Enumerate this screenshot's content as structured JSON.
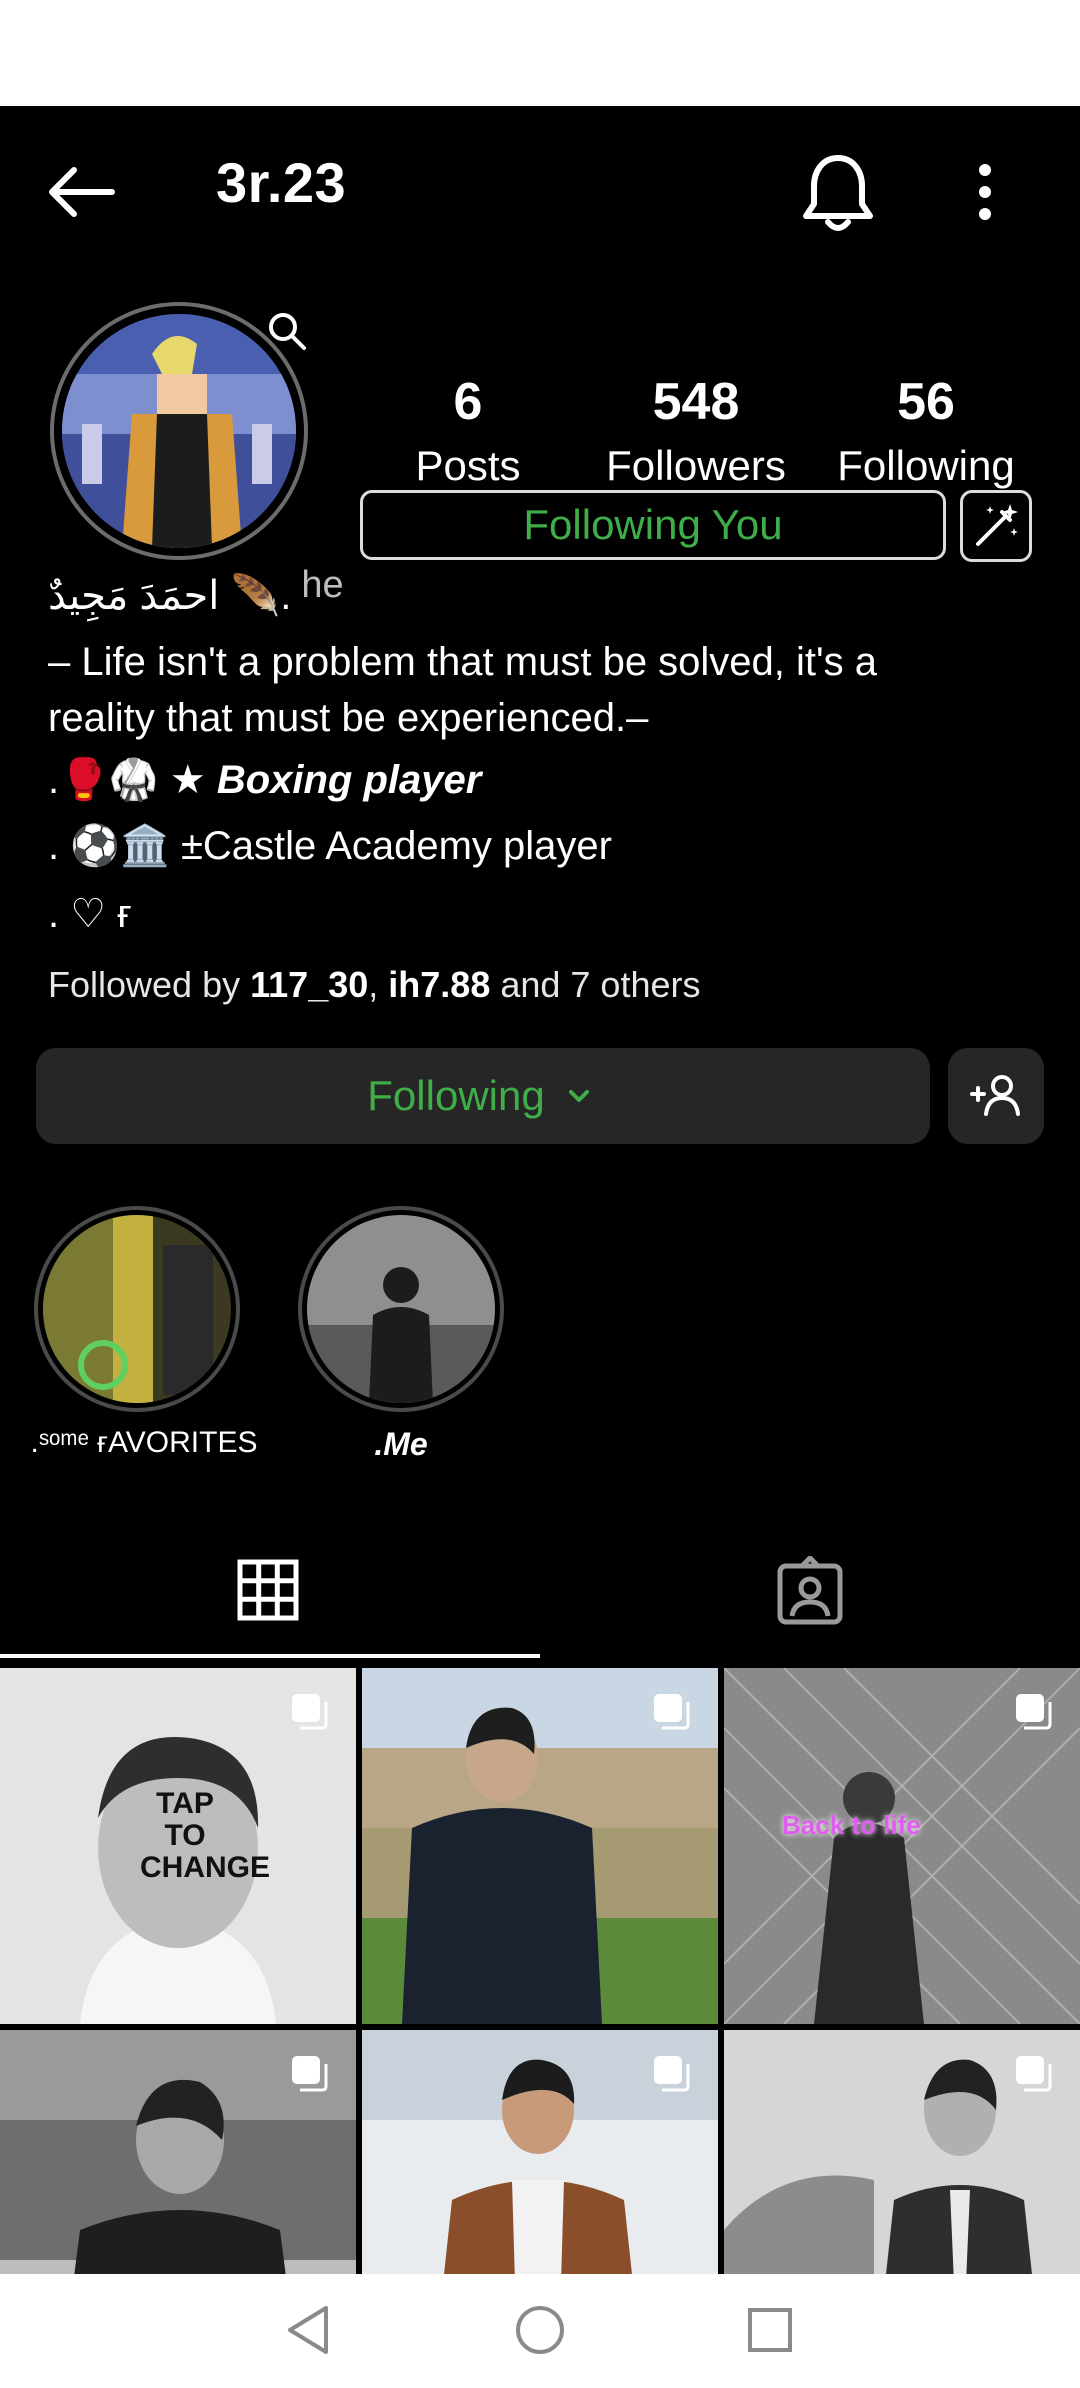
{
  "header": {
    "username": "3r.23"
  },
  "stats": [
    {
      "value": "6",
      "label": "Posts"
    },
    {
      "value": "548",
      "label": "Followers"
    },
    {
      "value": "56",
      "label": "Following"
    }
  ],
  "follows_you_label": "Following You",
  "bio": {
    "name": "احمَدَ مَجِيدٌ 🪶.",
    "name_suffix": "he",
    "line1": "– Life isn't a problem that must be solved, it's a",
    "line2": "reality that must be experienced.–",
    "line3_prefix": ".🥊🥋 ★ ",
    "line3_bold": "Boxing player",
    "line4": " .  ⚽🏛️  ±Castle Academy player",
    "line5": ". ♡ ғ"
  },
  "followed_by": {
    "prefix": "Followed by ",
    "user1": "117_30",
    "sep": ", ",
    "user2": "ih7.88",
    "suffix": " and 7 others"
  },
  "following_button": "Following",
  "highlights": [
    {
      "label": ".ˢᵒᵐᵉ ғAVORITES"
    },
    {
      "label": ".Me"
    }
  ],
  "posts": [
    {
      "caption": "TAP TO CHANGE"
    },
    {
      "caption": ""
    },
    {
      "caption": "Back to life"
    },
    {
      "caption": ""
    },
    {
      "caption": ""
    },
    {
      "caption": ""
    }
  ],
  "colors": {
    "accent_green": "#3fae49",
    "background": "#000000",
    "button_bg": "#262626"
  },
  "icons": [
    "back-arrow-icon",
    "bell-icon",
    "more-vertical-icon",
    "search-icon",
    "magic-wand-icon",
    "chevron-down-icon",
    "add-user-icon",
    "grid-icon",
    "tagged-icon",
    "multi-post-icon",
    "nav-back-icon",
    "nav-home-icon",
    "nav-recents-icon"
  ]
}
